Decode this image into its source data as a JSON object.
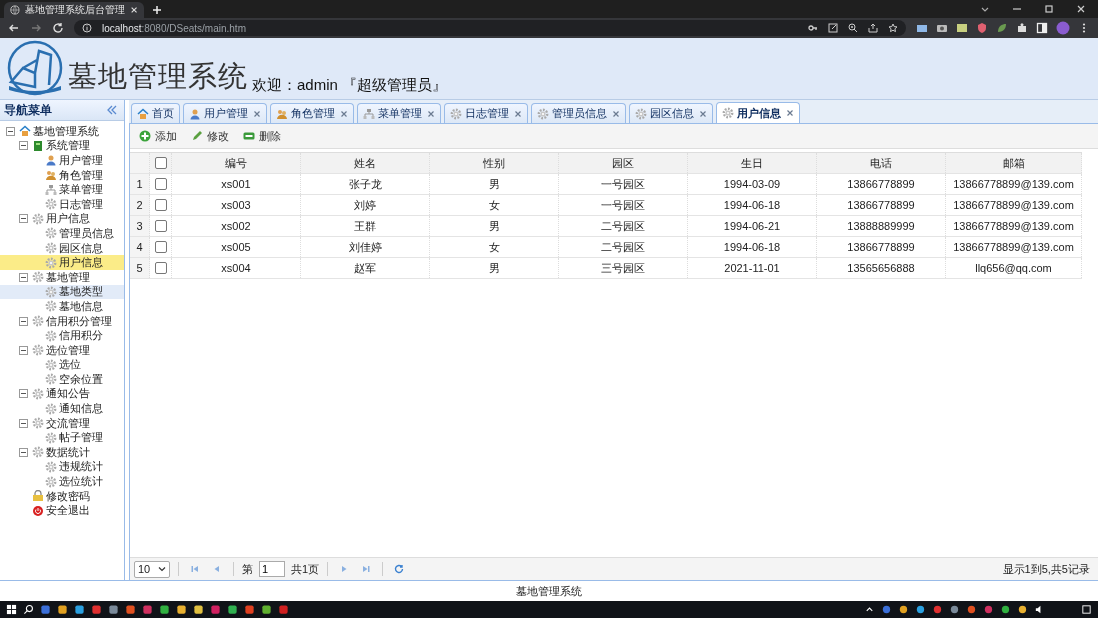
{
  "browser": {
    "tab_title": "墓地管理系统后台管理",
    "url_host": "localhost",
    "url_path": ":8080/DSeats/main.htm"
  },
  "header": {
    "title": "墓地管理系统",
    "welcome": "欢迎：admin 『超级管理员』"
  },
  "sidebar": {
    "title": "导航菜单",
    "tree": [
      {
        "label": "墓地管理系统",
        "kind": "home",
        "expanded": true,
        "selected": false,
        "hovered": false,
        "children": [
          {
            "label": "系统管理",
            "kind": "book",
            "expanded": true,
            "selected": false,
            "hovered": false,
            "children": [
              {
                "label": "用户管理",
                "kind": "user",
                "selected": false,
                "hovered": false
              },
              {
                "label": "角色管理",
                "kind": "users",
                "selected": false,
                "hovered": false
              },
              {
                "label": "菜单管理",
                "kind": "sitemap",
                "selected": false,
                "hovered": false
              },
              {
                "label": "日志管理",
                "kind": "gear",
                "selected": false,
                "hovered": false
              }
            ]
          },
          {
            "label": "用户信息",
            "kind": "gear",
            "expanded": true,
            "selected": false,
            "hovered": false,
            "children": [
              {
                "label": "管理员信息",
                "kind": "gear",
                "selected": false,
                "hovered": false
              },
              {
                "label": "园区信息",
                "kind": "gear",
                "selected": false,
                "hovered": false
              },
              {
                "label": "用户信息",
                "kind": "gear",
                "selected": true,
                "hovered": false
              }
            ]
          },
          {
            "label": "墓地管理",
            "kind": "gear",
            "expanded": true,
            "selected": false,
            "hovered": false,
            "children": [
              {
                "label": "墓地类型",
                "kind": "gear",
                "selected": false,
                "hovered": true
              },
              {
                "label": "墓地信息",
                "kind": "gear",
                "selected": false,
                "hovered": false
              }
            ]
          },
          {
            "label": "信用积分管理",
            "kind": "gear",
            "expanded": true,
            "selected": false,
            "hovered": false,
            "children": [
              {
                "label": "信用积分",
                "kind": "gear",
                "selected": false,
                "hovered": false
              }
            ]
          },
          {
            "label": "选位管理",
            "kind": "gear",
            "expanded": true,
            "selected": false,
            "hovered": false,
            "children": [
              {
                "label": "选位",
                "kind": "gear",
                "selected": false,
                "hovered": false
              },
              {
                "label": "空余位置",
                "kind": "gear",
                "selected": false,
                "hovered": false
              }
            ]
          },
          {
            "label": "通知公告",
            "kind": "gear",
            "expanded": true,
            "selected": false,
            "hovered": false,
            "children": [
              {
                "label": "通知信息",
                "kind": "gear",
                "selected": false,
                "hovered": false
              }
            ]
          },
          {
            "label": "交流管理",
            "kind": "gear",
            "expanded": true,
            "selected": false,
            "hovered": false,
            "children": [
              {
                "label": "帖子管理",
                "kind": "gear",
                "selected": false,
                "hovered": false
              }
            ]
          },
          {
            "label": "数据统计",
            "kind": "gear",
            "expanded": true,
            "selected": false,
            "hovered": false,
            "children": [
              {
                "label": "违规统计",
                "kind": "gear",
                "selected": false,
                "hovered": false
              },
              {
                "label": "选位统计",
                "kind": "gear",
                "selected": false,
                "hovered": false
              }
            ]
          },
          {
            "label": "修改密码",
            "kind": "lock",
            "selected": false,
            "hovered": false
          },
          {
            "label": "安全退出",
            "kind": "exit",
            "selected": false,
            "hovered": false
          }
        ]
      }
    ]
  },
  "tabs": [
    {
      "label": "首页",
      "kind": "home",
      "closable": false,
      "selected": false
    },
    {
      "label": "用户管理",
      "kind": "user",
      "closable": true,
      "selected": false
    },
    {
      "label": "角色管理",
      "kind": "users",
      "closable": true,
      "selected": false
    },
    {
      "label": "菜单管理",
      "kind": "sitemap",
      "closable": true,
      "selected": false
    },
    {
      "label": "日志管理",
      "kind": "gear",
      "closable": true,
      "selected": false
    },
    {
      "label": "管理员信息",
      "kind": "gear",
      "closable": true,
      "selected": false
    },
    {
      "label": "园区信息",
      "kind": "gear",
      "closable": true,
      "selected": false
    },
    {
      "label": "用户信息",
      "kind": "gear",
      "closable": true,
      "selected": true
    }
  ],
  "toolbar": [
    {
      "label": "添加",
      "kind": "add"
    },
    {
      "label": "修改",
      "kind": "edit"
    },
    {
      "label": "删除",
      "kind": "remove"
    }
  ],
  "table": {
    "select_all_checked": false,
    "columns": [
      "编号",
      "姓名",
      "性别",
      "园区",
      "生日",
      "电话",
      "邮箱"
    ],
    "rows": [
      {
        "number": "1",
        "checked": false,
        "cells": [
          "xs001",
          "张子龙",
          "男",
          "一号园区",
          "1994-03-09",
          "13866778899",
          "13866778899@139.com"
        ]
      },
      {
        "number": "2",
        "checked": false,
        "cells": [
          "xs003",
          "刘婷",
          "女",
          "一号园区",
          "1994-06-18",
          "13866778899",
          "13866778899@139.com"
        ]
      },
      {
        "number": "3",
        "checked": false,
        "cells": [
          "xs002",
          "王群",
          "男",
          "二号园区",
          "1994-06-21",
          "13888889999",
          "13866778899@139.com"
        ]
      },
      {
        "number": "4",
        "checked": false,
        "cells": [
          "xs005",
          "刘佳婷",
          "女",
          "二号园区",
          "1994-06-18",
          "13866778899",
          "13866778899@139.com"
        ]
      },
      {
        "number": "5",
        "checked": false,
        "cells": [
          "xs004",
          "赵军",
          "男",
          "三号园区",
          "2021-11-01",
          "13565656888",
          "llq656@qq.com"
        ]
      }
    ]
  },
  "pager": {
    "page_size": "10",
    "page_prefix": "第",
    "page": "1",
    "page_total": "共1页",
    "summary": "显示1到5,共5记录"
  },
  "footer": "墓地管理系统"
}
